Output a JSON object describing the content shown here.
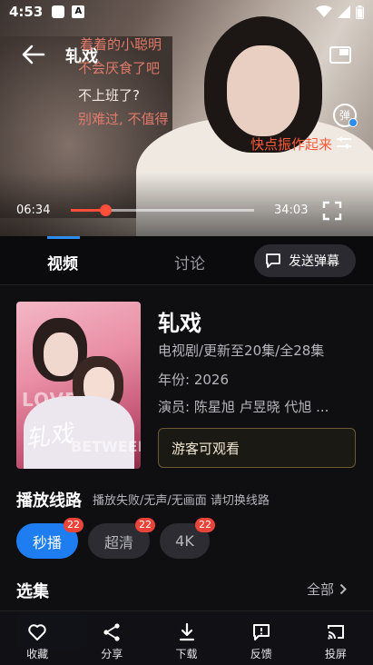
{
  "status_bar": {
    "time": "4:53"
  },
  "player": {
    "title": "轧戏",
    "danmu": [
      "着着的小聪明",
      "不会厌食了吧",
      "不上班了?",
      "别难过, 不值得",
      "快点振作起来"
    ],
    "danmu_toggle_label": "弹",
    "current_time": "06:34",
    "total_time": "34:03",
    "progress": 0.19
  },
  "tabs": {
    "video": "视频",
    "discuss": "讨论",
    "send_danmu": "发送弹幕"
  },
  "info": {
    "poster_text": "轧戏",
    "title": "轧戏",
    "type_line": "电视剧/更新至20集/全28集",
    "year_line": "年份: 2026",
    "cast_line": "演员: 陈星旭 卢昱晓 代旭 ...",
    "guest_button": "游客可观看"
  },
  "lines": {
    "title": "播放线路",
    "hint": "播放失败/无声/无画面 请切换线路",
    "chips": [
      {
        "label": "秒播",
        "badge": "22",
        "active": true
      },
      {
        "label": "超清",
        "badge": "22",
        "active": false
      },
      {
        "label": "4K",
        "badge": "22",
        "active": false
      }
    ]
  },
  "episodes": {
    "title": "选集",
    "all_label": "全部"
  },
  "bottom_nav": {
    "favorite": "收藏",
    "share": "分享",
    "download": "下载",
    "feedback": "反馈",
    "cast": "投屏"
  },
  "colors": {
    "accent": "#1e7df0",
    "progress": "#ff4e3a",
    "badge": "#e9443a"
  }
}
